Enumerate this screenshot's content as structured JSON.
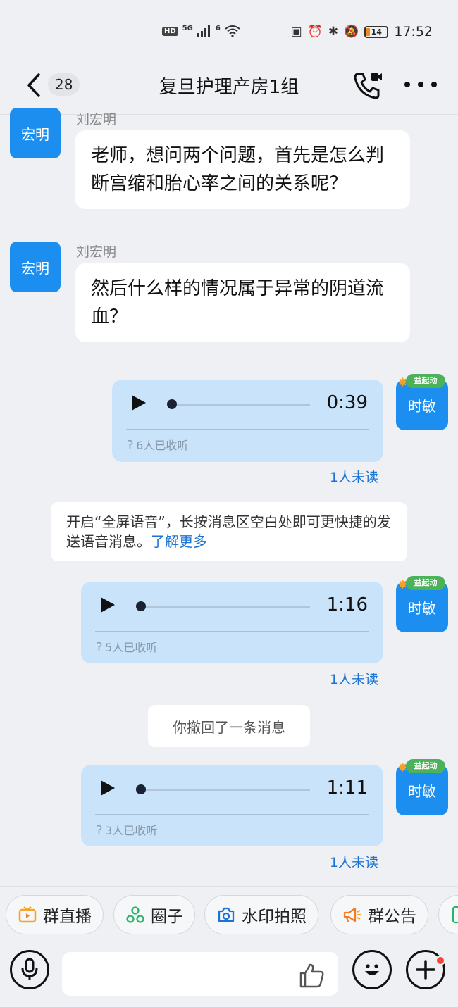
{
  "status_bar": {
    "left_badges": [
      "HD",
      "5G",
      "6"
    ],
    "time": "17:52",
    "battery": "14"
  },
  "header": {
    "unread_count": "28",
    "title": "复旦护理产房1组"
  },
  "messages": [
    {
      "type": "text",
      "direction": "incoming",
      "sender": "刘宏明",
      "avatar_label": "宏明",
      "text": "老师，想问两个问题，首先是怎么判断宫缩和胎心率之间的关系呢？"
    },
    {
      "type": "text",
      "direction": "incoming",
      "sender": "刘宏明",
      "avatar_label": "宏明",
      "text": "然后什么样的情况属于异常的阴道流血？"
    },
    {
      "type": "voice",
      "direction": "outgoing",
      "avatar_label": "时敏",
      "duration": "0:39",
      "listened": "6人已收听",
      "unread": "1人未读"
    },
    {
      "type": "tip",
      "text": "开启“全屏语音”，长按消息区空白处即可更快捷的发送语音消息。",
      "link": "了解更多"
    },
    {
      "type": "voice",
      "direction": "outgoing",
      "avatar_label": "时敏",
      "duration": "1:16",
      "listened": "5人已收听",
      "unread": "1人未读"
    },
    {
      "type": "system",
      "text": "你撤回了一条消息"
    },
    {
      "type": "voice",
      "direction": "outgoing",
      "avatar_label": "时敏",
      "duration": "1:11",
      "listened": "3人已收听",
      "unread": "1人未读"
    }
  ],
  "avatar_sticker": "益起动",
  "quick_actions": [
    {
      "label": "群直播",
      "icon": "live-tv-icon",
      "color": "#f5a623"
    },
    {
      "label": "圈子",
      "icon": "circle-group-icon",
      "color": "#2db46b"
    },
    {
      "label": "水印拍照",
      "icon": "camera-icon",
      "color": "#1b73d6"
    },
    {
      "label": "群公告",
      "icon": "megaphone-icon",
      "color": "#f57c23"
    }
  ],
  "input_bar": {
    "placeholder": "",
    "icons": [
      "microphone-icon",
      "thumbs-up-icon",
      "emoji-icon",
      "plus-icon"
    ]
  },
  "colors": {
    "accent": "#1b8ef0",
    "link": "#1b73d6",
    "voice_bubble": "#c9e3fb",
    "background": "#eef0f4"
  }
}
